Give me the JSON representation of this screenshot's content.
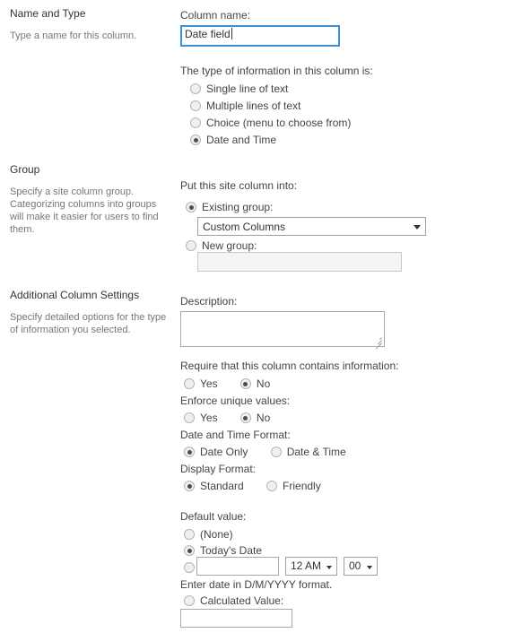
{
  "form": {
    "sections": [
      {
        "id": "name-and-type",
        "title": "Name and Type",
        "description": "Type a name for this column."
      },
      {
        "id": "group",
        "title": "Group",
        "description": "Specify a site column group. Categorizing columns into groups will make it easier for users to find them."
      },
      {
        "id": "additional-column-settings",
        "title": "Additional Column Settings",
        "description": "Specify detailed options for the type of information you selected."
      }
    ]
  },
  "column_name": {
    "label": "Column name:",
    "value": "Date field",
    "focused": true
  },
  "column_type": {
    "label": "The type of information in this column is:",
    "options": [
      {
        "label": "Single line of text",
        "checked": false
      },
      {
        "label": "Multiple lines of text",
        "checked": false
      },
      {
        "label": "Choice (menu to choose from)",
        "checked": false
      },
      {
        "label": "Date and Time",
        "checked": true
      }
    ]
  },
  "group": {
    "label": "Put this site column into:",
    "existing_group": {
      "label": "Existing group:",
      "checked": true,
      "selected": "Custom Columns"
    },
    "new_group": {
      "label": "New group:",
      "checked": false,
      "value": ""
    }
  },
  "description": {
    "label": "Description:",
    "value": ""
  },
  "require_info": {
    "label": "Require that this column contains information:",
    "options": [
      {
        "label": "Yes",
        "checked": false
      },
      {
        "label": "No",
        "checked": true
      }
    ]
  },
  "enforce_unique": {
    "label": "Enforce unique values:",
    "options": [
      {
        "label": "Yes",
        "checked": false
      },
      {
        "label": "No",
        "checked": true
      }
    ]
  },
  "datetime_format": {
    "label": "Date and Time Format:",
    "options": [
      {
        "label": "Date Only",
        "checked": true
      },
      {
        "label": "Date & Time",
        "checked": false
      }
    ]
  },
  "display_format": {
    "label": "Display Format:",
    "options": [
      {
        "label": "Standard",
        "checked": true
      },
      {
        "label": "Friendly",
        "checked": false
      }
    ]
  },
  "default_value": {
    "label": "Default value:",
    "none": {
      "label": "(None)",
      "checked": false
    },
    "today": {
      "label": "Today's Date",
      "checked": true
    },
    "specific": {
      "checked": false,
      "date_value": ""
    },
    "hour_select": "12 AM",
    "minute_select": "00",
    "hint": "Enter date in D/M/YYYY format.",
    "calculated": {
      "label": "Calculated Value:",
      "checked": false,
      "value": ""
    }
  },
  "colors": {
    "focus_border": "#3b8fd4",
    "text": "#444444",
    "muted_text": "#767676",
    "heading": "#333333",
    "input_border": "#a0a0a0",
    "radio_dot": "#4c4c4c"
  }
}
